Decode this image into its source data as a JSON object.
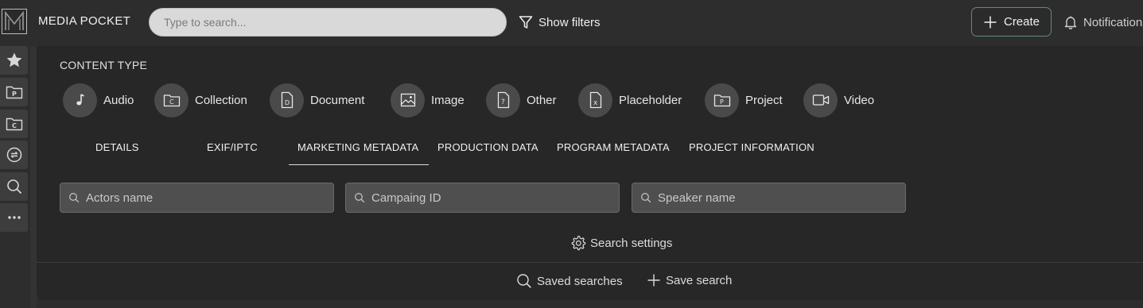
{
  "header": {
    "brand": "MEDIA POCKET",
    "search_placeholder": "Type to search...",
    "show_filters_label": "Show filters",
    "create_label": "Create",
    "notifications_label": "Notifications"
  },
  "sidebar": {
    "items": [
      {
        "icon": "star-icon"
      },
      {
        "icon": "project-folder-icon"
      },
      {
        "icon": "collection-folder-icon"
      },
      {
        "icon": "sync-icon"
      },
      {
        "icon": "search-icon"
      },
      {
        "icon": "more-icon"
      }
    ]
  },
  "content_type": {
    "title": "CONTENT TYPE",
    "types": [
      {
        "label": "Audio",
        "icon": "music-note-icon"
      },
      {
        "label": "Collection",
        "icon": "collection-icon"
      },
      {
        "label": "Document",
        "icon": "document-icon"
      },
      {
        "label": "Image",
        "icon": "image-icon"
      },
      {
        "label": "Other",
        "icon": "other-file-icon"
      },
      {
        "label": "Placeholder",
        "icon": "placeholder-icon"
      },
      {
        "label": "Project",
        "icon": "project-icon"
      },
      {
        "label": "Video",
        "icon": "video-icon"
      }
    ]
  },
  "tabs": {
    "items": [
      "DETAILS",
      "EXIF/IPTC",
      "MARKETING METADATA",
      "PRODUCTION DATA",
      "PROGRAM METADATA",
      "PROJECT INFORMATION"
    ],
    "active": "MARKETING METADATA"
  },
  "fields": [
    {
      "placeholder": "Actors name"
    },
    {
      "placeholder": "Campaing ID"
    },
    {
      "placeholder": "Speaker name"
    }
  ],
  "search_settings_label": "Search settings",
  "footer": {
    "saved_searches_label": "Saved searches",
    "save_search_label": "Save search"
  },
  "colors": {
    "background": "#2d2d2d",
    "panel": "#272727",
    "create_border": "#5f8a80"
  }
}
